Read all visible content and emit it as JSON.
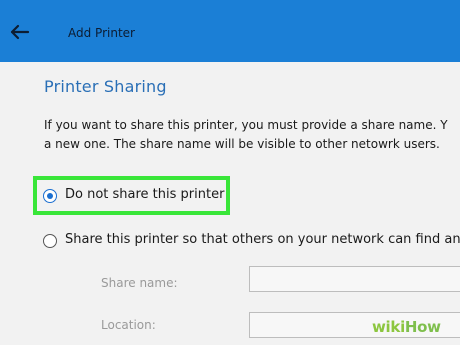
{
  "window": {
    "title": "Add Printer",
    "accent_color": "#1b7fd6"
  },
  "section": {
    "heading": "Printer Sharing",
    "description_line1": "If you want to share this printer, you must provide a share name. Y",
    "description_line2": "a new one. The share name will be visible to other netowrk users."
  },
  "options": {
    "do_not_share": {
      "label": "Do not share this printer",
      "selected": true
    },
    "share": {
      "label": "Share this printer so that others on your network can find and u",
      "selected": false
    }
  },
  "fields": {
    "share_name_label": "Share name:",
    "share_name_value": "",
    "location_label": "Location:",
    "location_value": ""
  },
  "highlight_color": "#39e639",
  "watermark": {
    "wiki": "wiki",
    "how": "How"
  }
}
